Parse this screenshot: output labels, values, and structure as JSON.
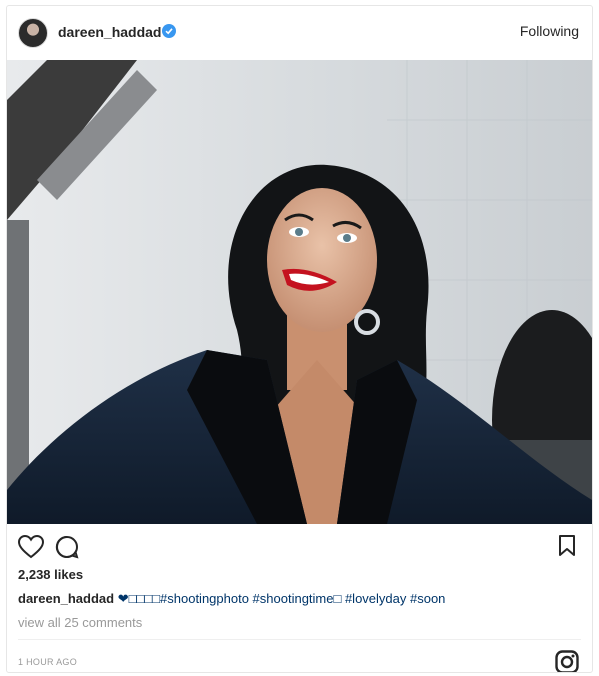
{
  "header": {
    "username": "dareen_haddad",
    "verified": true,
    "follow_label": "Following"
  },
  "post": {
    "likes": "2,238 likes",
    "caption_user": "dareen_haddad",
    "caption_text": "❤□□□□#shootingphoto #shootingtime□ #lovelyday #soon",
    "view_comments": "view all 25 comments",
    "timestamp": "1 HOUR AGO"
  },
  "icons": {
    "like": "heart-icon",
    "comment": "comment-icon",
    "save": "bookmark-icon",
    "brand": "instagram-icon",
    "verified": "verified-badge-icon"
  },
  "colors": {
    "verified_blue": "#3897f0",
    "hashtag": "#003569",
    "muted": "#999999",
    "text": "#262626"
  }
}
